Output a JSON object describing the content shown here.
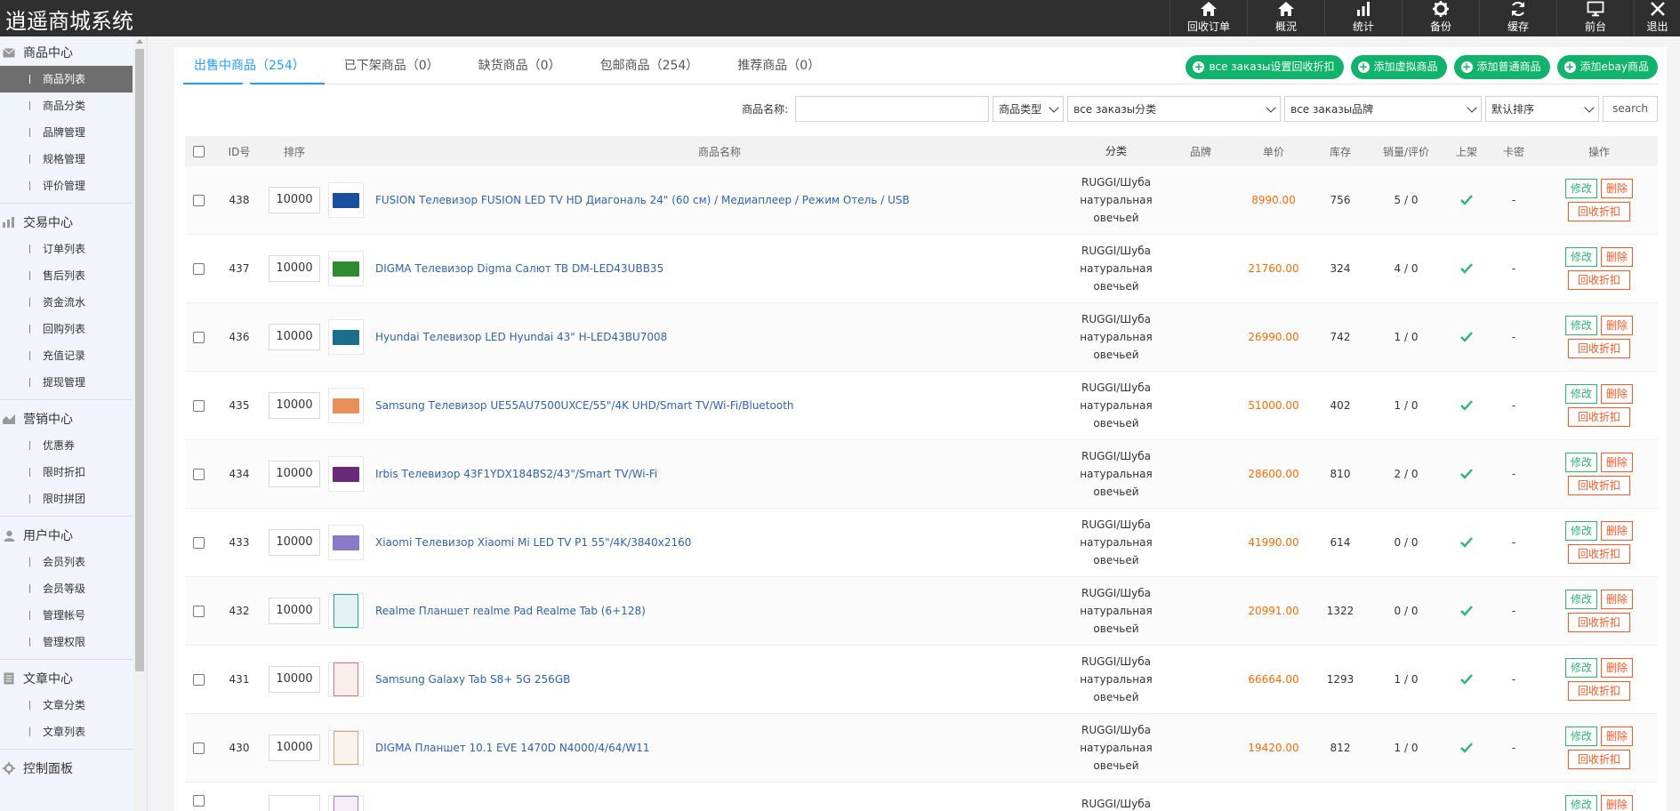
{
  "header": {
    "brand": "逍遥商城系统",
    "nav": [
      {
        "label": "回收订单",
        "icon": "home-icon"
      },
      {
        "label": "概況",
        "icon": "home-icon"
      },
      {
        "label": "统计",
        "icon": "bar-chart-icon"
      },
      {
        "label": "备份",
        "icon": "gear-icon"
      },
      {
        "label": "缓存",
        "icon": "refresh-icon"
      },
      {
        "label": "前台",
        "icon": "monitor-icon"
      },
      {
        "label": "退出",
        "icon": "close-icon"
      }
    ]
  },
  "sidebar": {
    "groups": [
      {
        "title": "商品中心",
        "icon": "envelope-icon",
        "items": [
          "商品列表",
          "商品分类",
          "品牌管理",
          "规格管理",
          "评价管理"
        ]
      },
      {
        "title": "交易中心",
        "icon": "bar-chart-icon",
        "items": [
          "订单列表",
          "售后列表",
          "资金流水",
          "回购列表",
          "充值记录",
          "提现管理"
        ]
      },
      {
        "title": "营销中心",
        "icon": "area-chart-icon",
        "items": [
          "优惠券",
          "限时折扣",
          "限时拼团"
        ]
      },
      {
        "title": "用户中心",
        "icon": "user-icon",
        "items": [
          "会员列表",
          "会员等级",
          "管理帐号",
          "管理权限"
        ]
      },
      {
        "title": "文章中心",
        "icon": "document-icon",
        "items": [
          "文章分类",
          "文章列表"
        ]
      },
      {
        "title": "控制面板",
        "icon": "gear-icon",
        "items": []
      }
    ]
  },
  "tabs": [
    "出售中商品（254）",
    "已下架商品（0）",
    "缺货商品（0）",
    "包邮商品（254）",
    "推荐商品（0）"
  ],
  "actions": [
    "все заказы设置回收折扣",
    "添加虚拟商品",
    "添加普通商品",
    "添加ebay商品"
  ],
  "filters": {
    "name_label": "商品名称:",
    "name_value": "",
    "type_select": "商品类型",
    "category_select": "все заказы分类",
    "brand_select": "все заказы品牌",
    "sort_select": "默认排序",
    "search_label": "search"
  },
  "table": {
    "headers": {
      "id": "ID号",
      "sort": "排序",
      "name": "商品名称",
      "category": "分类",
      "brand": "品牌",
      "price": "单价",
      "stock": "库存",
      "sales": "销量/评价",
      "onsale": "上架",
      "card": "卡密",
      "ops": "操作"
    },
    "ops": {
      "edit": "修改",
      "delete": "删除",
      "discount": "回收折扣"
    },
    "rows": [
      {
        "id": "438",
        "sort": "10000",
        "name": "FUSION Телевизор FUSION LED TV HD Диагональ 24\" (60 см) / Медиаплеер / Режим Отель / USB",
        "cat1": "RUGGI/Шуба",
        "cat2": "натуральная",
        "cat3": "овечьей",
        "brand": "",
        "price": "8990.00",
        "stock": "756",
        "sales": "5 / 0",
        "card": "-",
        "thumb": "#1a4fa0"
      },
      {
        "id": "437",
        "sort": "10000",
        "name": "DIGMA Телевизор Digma Салют ТВ DM-LED43UBB35",
        "cat1": "RUGGI/Шуба",
        "cat2": "натуральная",
        "cat3": "овечьей",
        "brand": "",
        "price": "21760.00",
        "stock": "324",
        "sales": "4 / 0",
        "card": "-",
        "thumb": "#2e8b2e"
      },
      {
        "id": "436",
        "sort": "10000",
        "name": "Hyundai Телевизор LED Hyundai 43\" H-LED43BU7008",
        "cat1": "RUGGI/Шуба",
        "cat2": "натуральная",
        "cat3": "овечьей",
        "brand": "",
        "price": "26990.00",
        "stock": "742",
        "sales": "1 / 0",
        "card": "-",
        "thumb": "#1c6f8a"
      },
      {
        "id": "435",
        "sort": "10000",
        "name": "Samsung Телевизор UE55AU7500UXCE/55\"/4K UHD/Smart TV/Wi-Fi/Bluetooth",
        "cat1": "RUGGI/Шуба",
        "cat2": "натуральная",
        "cat3": "овечьей",
        "brand": "",
        "price": "51000.00",
        "stock": "402",
        "sales": "1 / 0",
        "card": "-",
        "thumb": "#e8905a"
      },
      {
        "id": "434",
        "sort": "10000",
        "name": "Irbis Телевизор 43F1YDX184BS2/43\"/Smart TV/Wi-Fi",
        "cat1": "RUGGI/Шуба",
        "cat2": "натуральная",
        "cat3": "овечьей",
        "brand": "",
        "price": "28600.00",
        "stock": "810",
        "sales": "2 / 0",
        "card": "-",
        "thumb": "#6a2a7a"
      },
      {
        "id": "433",
        "sort": "10000",
        "name": "Xiaomi Телевизор Xiaomi Mi LED TV P1 55\"/4K/3840x2160",
        "cat1": "RUGGI/Шуба",
        "cat2": "натуральная",
        "cat3": "овечьей",
        "brand": "",
        "price": "41990.00",
        "stock": "614",
        "sales": "0 / 0",
        "card": "-",
        "thumb": "#8a7ac8"
      },
      {
        "id": "432",
        "sort": "10000",
        "name": "Realme Планшет realme Pad Realme Tab (6+128)",
        "cat1": "RUGGI/Шуба",
        "cat2": "натуральная",
        "cat3": "овечьей",
        "brand": "",
        "price": "20991.00",
        "stock": "1322",
        "sales": "0 / 0",
        "card": "-",
        "thumb": "#2aa5a0"
      },
      {
        "id": "431",
        "sort": "10000",
        "name": "Samsung Galaxy Tab S8+ 5G 256GB",
        "cat1": "RUGGI/Шуба",
        "cat2": "натуральная",
        "cat3": "овечьей",
        "brand": "",
        "price": "66664.00",
        "stock": "1293",
        "sales": "1 / 0",
        "card": "-",
        "thumb": "#d9787a"
      },
      {
        "id": "430",
        "sort": "10000",
        "name": "DIGMA Планшет 10.1 EVE 1470D N4000/4/64/W11",
        "cat1": "RUGGI/Шуба",
        "cat2": "натуральная",
        "cat3": "овечьей",
        "brand": "",
        "price": "19420.00",
        "stock": "812",
        "sales": "1 / 0",
        "card": "-",
        "thumb": "#c9a57a"
      },
      {
        "id": "",
        "sort": "",
        "name": "",
        "cat1": "RUGGI/Шуба",
        "cat2": "",
        "cat3": "",
        "brand": "",
        "price": "",
        "stock": "",
        "sales": "",
        "card": "",
        "thumb": "#b07ac8"
      }
    ]
  },
  "colors": {
    "accent": "#1e9fff",
    "green": "#10b36b",
    "price": "#ff6a00",
    "danger": "#ff5722",
    "topbar": "#2f2f2f"
  }
}
